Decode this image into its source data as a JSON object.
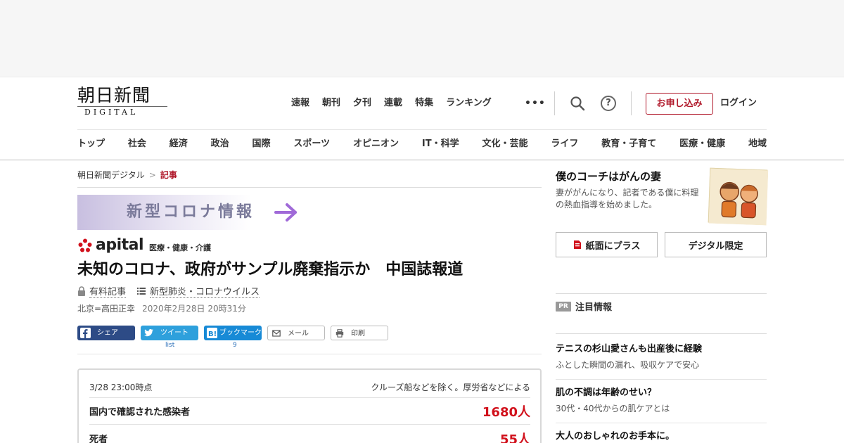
{
  "header": {
    "logo_jp": "朝日新聞",
    "logo_en": "DIGITAL",
    "top_nav": [
      "速報",
      "朝刊",
      "夕刊",
      "連載",
      "特集",
      "ランキング"
    ],
    "more": "•••",
    "signup_label": "お申し込み",
    "login_label": "ログイン",
    "categories": [
      "トップ",
      "社会",
      "経済",
      "政治",
      "国際",
      "スポーツ",
      "オピニオン",
      "IT・科学",
      "文化・芸能",
      "ライフ",
      "教育・子育て",
      "医療・健康",
      "地域"
    ]
  },
  "breadcrumb": {
    "home": "朝日新聞デジタル",
    "separator": ">",
    "current": "記事"
  },
  "banner": {
    "text": "新型コロナ情報"
  },
  "section": {
    "brand": "apital",
    "subtitle": "医療・健康・介護"
  },
  "article": {
    "title": "未知のコロナ、政府がサンプル廃棄指示か　中国誌報道",
    "paid_label": "有料記事",
    "topic_label": "新型肺炎・コロナウイルス",
    "author": "北京=高田正幸",
    "date": "2020年2月28日 20時31分"
  },
  "share": {
    "facebook": "シェア",
    "twitter": "ツイート",
    "hatena": "ブックマーク",
    "mail": "メール",
    "print": "印刷",
    "twitter_count": "list",
    "hatena_count": "9"
  },
  "stats": {
    "timestamp": "3/28 23:00時点",
    "note": "クルーズ船などを除く。厚労省などによる",
    "rows": [
      {
        "label": "国内で確認された感染者",
        "value": "1680人"
      },
      {
        "label": "死者",
        "value": "55人"
      }
    ]
  },
  "sidebar": {
    "coach_title": "僕のコーチはがんの妻",
    "coach_desc": "妻ががんになり、記者である僕に料理の熱血指導を始めました。",
    "paper_plus": "紙面にプラス",
    "digital_only": "デジタル限定",
    "pr_badge": "PR",
    "pr_label": "注目情報",
    "promos": [
      {
        "title": "テニスの杉山愛さんも出産後に経験",
        "desc": "ふとした瞬間の漏れ、吸収ケアで安心"
      },
      {
        "title": "肌の不調は年齢のせい？",
        "desc": "30代・40代からの肌ケアとは"
      },
      {
        "title": "大人のおしゃれのお手本に。",
        "desc": ""
      }
    ]
  },
  "colors": {
    "accent_red": "#b0182a",
    "value_red": "#d1111c",
    "facebook": "#2d4b86",
    "twitter": "#2ea0dc",
    "hatena": "#178ad6"
  }
}
